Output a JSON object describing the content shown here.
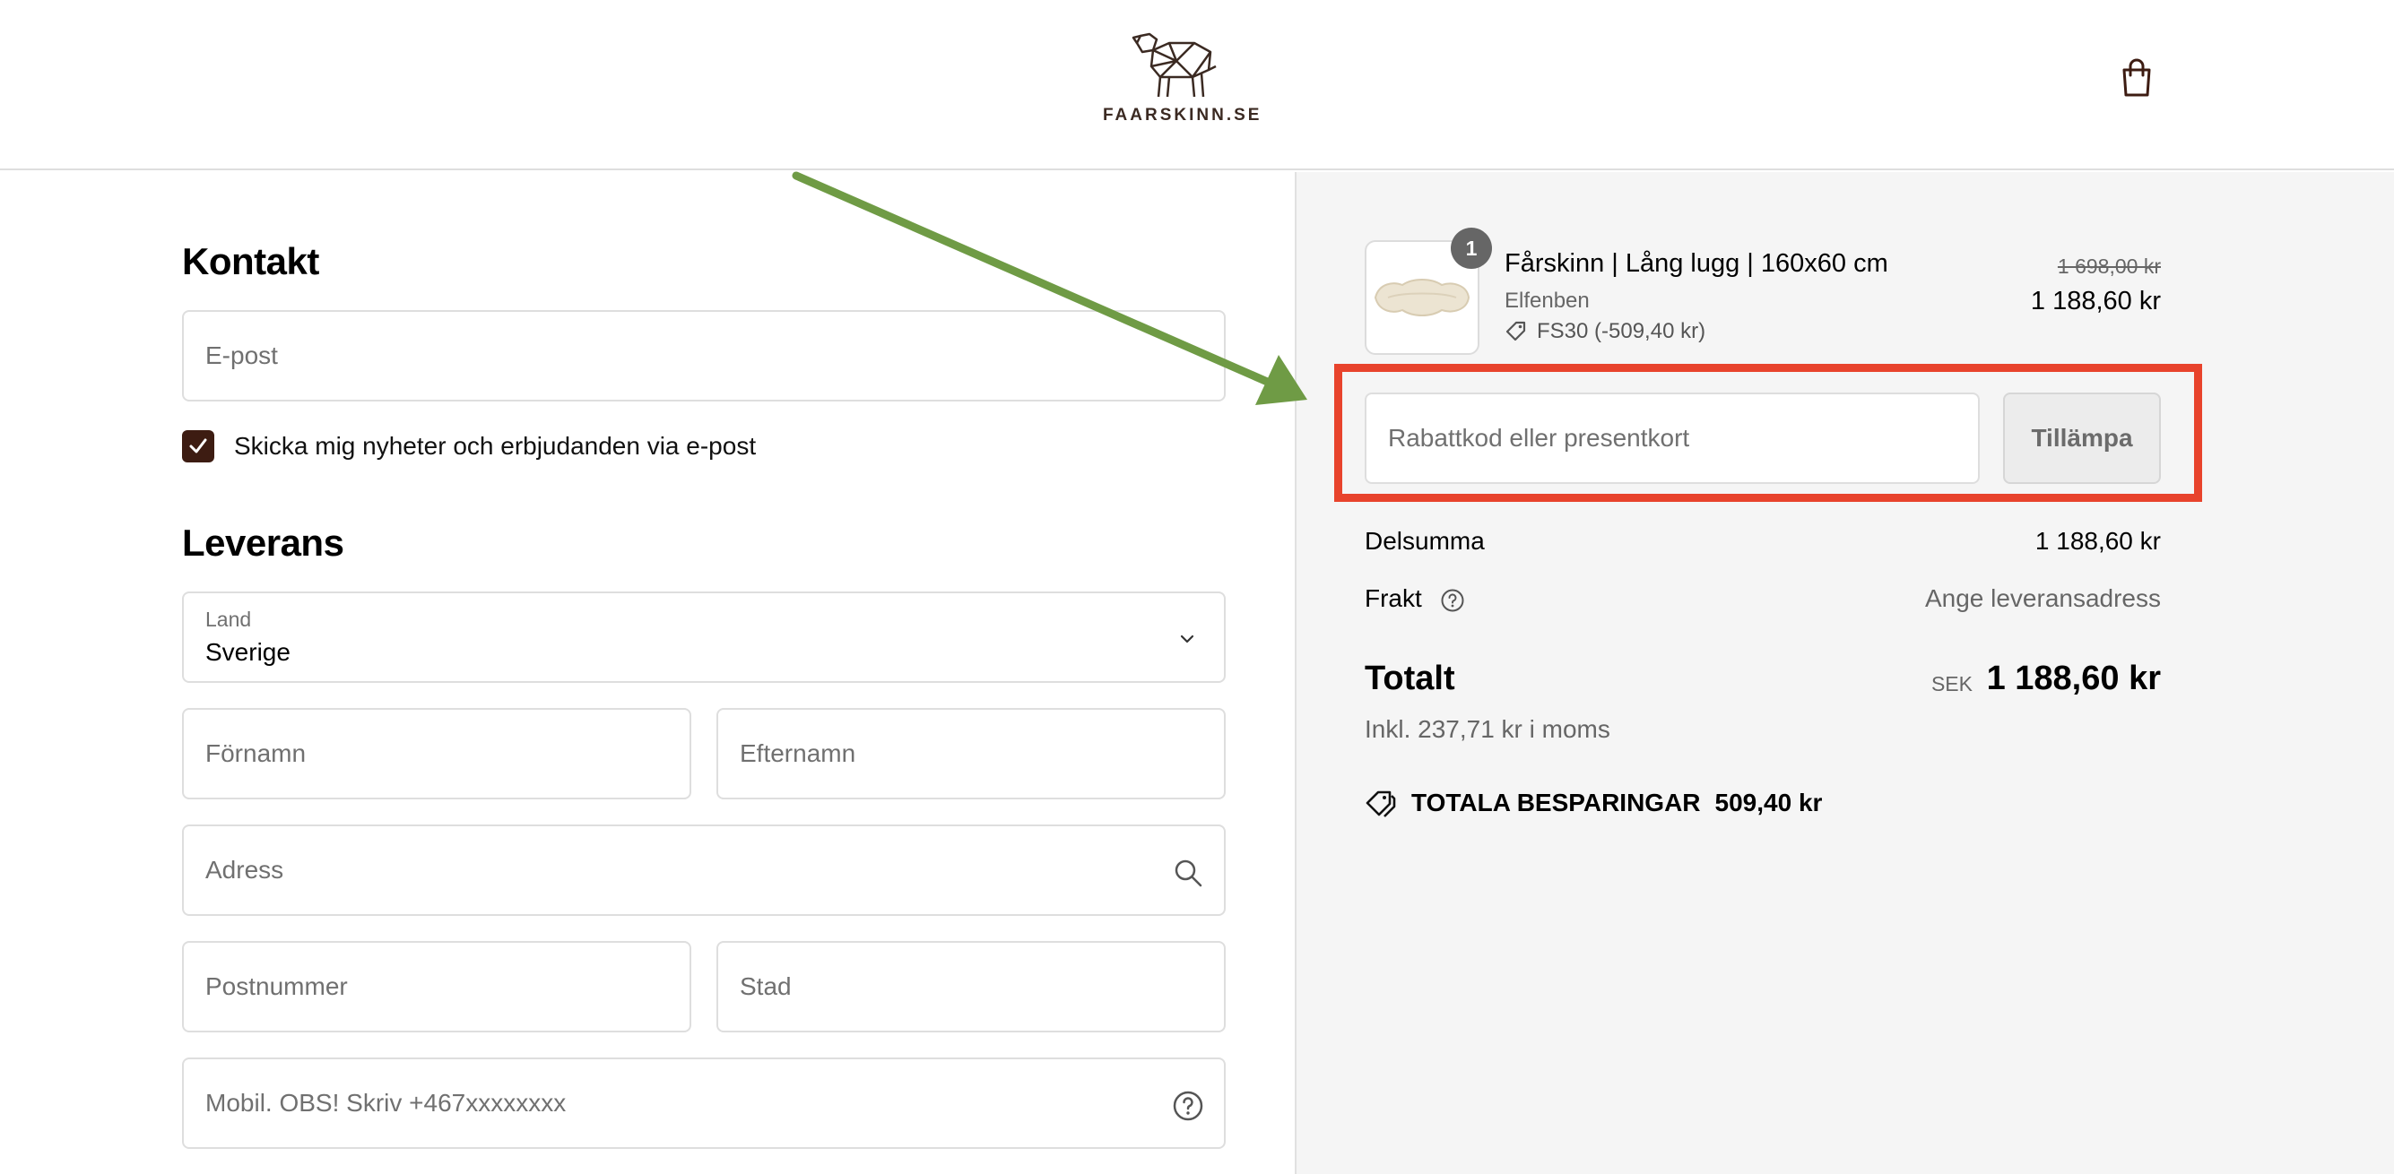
{
  "header": {
    "brand": "FAARSKINN.SE",
    "cart_icon": "shopping-bag-icon"
  },
  "contact": {
    "title": "Kontakt",
    "email_placeholder": "E-post",
    "newsletter_label": "Skicka mig nyheter och erbjudanden via e-post",
    "newsletter_checked": true
  },
  "delivery": {
    "title": "Leverans",
    "country_label": "Land",
    "country_value": "Sverige",
    "first_name_placeholder": "Förnamn",
    "last_name_placeholder": "Efternamn",
    "address_placeholder": "Adress",
    "postal_placeholder": "Postnummer",
    "city_placeholder": "Stad",
    "phone_placeholder": "Mobil. OBS! Skriv +467xxxxxxxx"
  },
  "order": {
    "item": {
      "quantity": "1",
      "name": "Fårskinn | Lång lugg | 160x60 cm",
      "variant": "Elfenben",
      "discount": "FS30 (-509,40 kr)",
      "price_original": "1 698,00 kr",
      "price_final": "1 188,60 kr"
    },
    "discount_placeholder": "Rabattkod eller presentkort",
    "apply_label": "Tillämpa",
    "subtotal_label": "Delsumma",
    "subtotal_value": "1 188,60 kr",
    "shipping_label": "Frakt",
    "shipping_value": "Ange leveransadress",
    "total_label": "Totalt",
    "total_currency": "SEK",
    "total_value": "1 188,60 kr",
    "tax_note": "Inkl. 237,71 kr i moms",
    "savings_label": "TOTALA BESPARINGAR",
    "savings_value": "509,40 kr"
  },
  "annotation": {
    "arrow_color": "#6f9b45",
    "box_color": "#e8432c"
  },
  "colors": {
    "brand_dark": "#3d1c12",
    "sidebar_bg": "#f5f5f5",
    "muted_text": "#666666"
  }
}
